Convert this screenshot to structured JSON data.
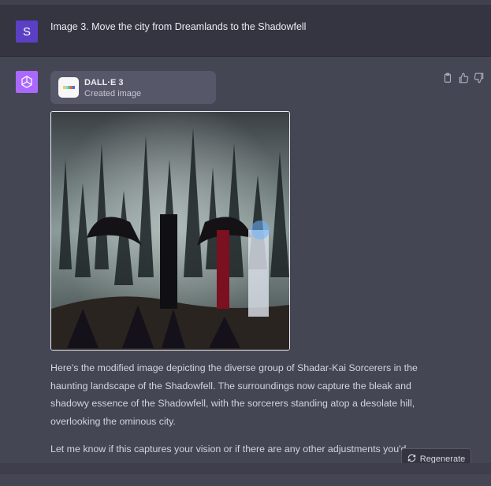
{
  "user": {
    "avatar_letter": "S",
    "message": "Image 3. Move the city from Dreamlands to the Shadowfell"
  },
  "assistant": {
    "tool_card": {
      "title": "DALL·E 3",
      "subtitle": "Created image"
    },
    "paragraphs": [
      "Here's the modified image depicting the diverse group of Shadar-Kai Sorcerers in the haunting landscape of the Shadowfell. The surroundings now capture the bleak and shadowy essence of the Shadowfell, with the sorcerers standing atop a desolate hill, overlooking the ominous city.",
      "Let me know if this captures your vision or if there are any other adjustments you'd like!"
    ]
  },
  "actions": {
    "regenerate_label": "Regenerate"
  },
  "icons": {
    "copy": "clipboard-icon",
    "thumbs_up": "thumbs-up-icon",
    "thumbs_down": "thumbs-down-icon",
    "regenerate": "refresh-icon",
    "openai": "openai-logo-icon"
  },
  "colors": {
    "user_avatar": "#5b3fc4",
    "bot_avatar": "#ab68ff",
    "bg_user": "#343541",
    "bg_assistant": "#444654"
  }
}
